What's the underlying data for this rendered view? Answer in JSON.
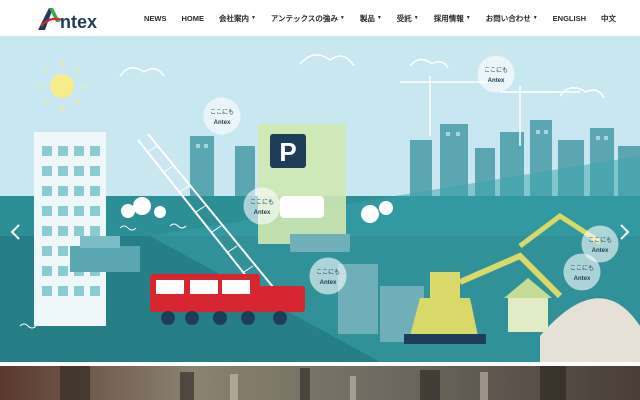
{
  "brand": {
    "logo_text": "Antex",
    "color_green": "#3aa84a",
    "color_red": "#d7262f",
    "color_navy": "#1e3d59"
  },
  "nav": {
    "items": [
      {
        "label": "NEWS",
        "dropdown": false
      },
      {
        "label": "HOME",
        "dropdown": false
      },
      {
        "label": "会社案内",
        "dropdown": true
      },
      {
        "label": "アンテックスの強み",
        "dropdown": true
      },
      {
        "label": "製品",
        "dropdown": true
      },
      {
        "label": "受託",
        "dropdown": true
      },
      {
        "label": "採用情報",
        "dropdown": true
      },
      {
        "label": "お問い合わせ",
        "dropdown": true
      },
      {
        "label": "ENGLISH",
        "dropdown": false
      },
      {
        "label": "中文",
        "dropdown": false
      }
    ]
  },
  "hero": {
    "parking_sign": "P",
    "bubble_text": "ここにも",
    "bubble_brand": "Antex",
    "sky_color": "#c9e7f1",
    "ground_color": "#2d8f96",
    "prev_icon": "chevron-left-icon",
    "next_icon": "chevron-right-icon"
  }
}
